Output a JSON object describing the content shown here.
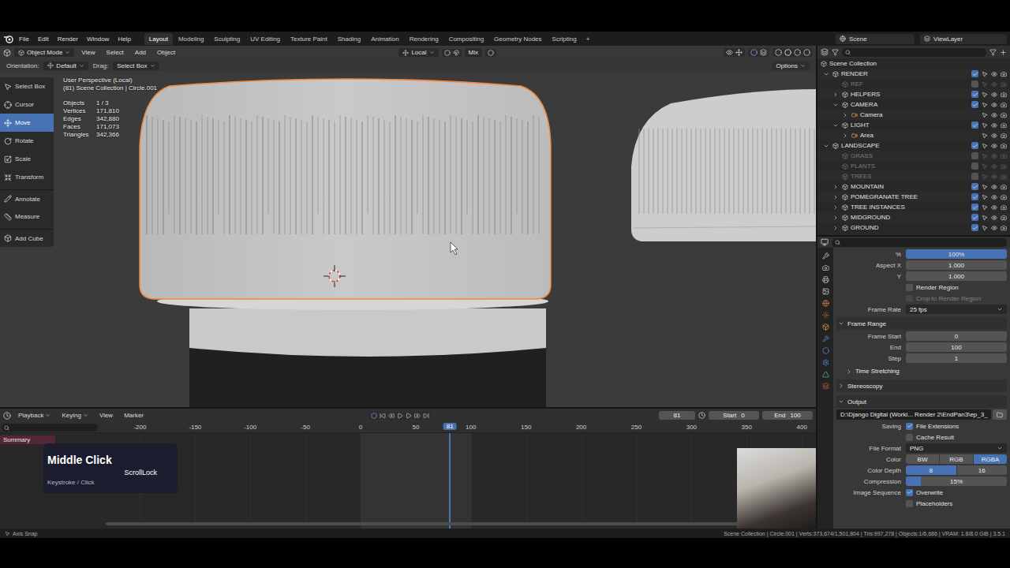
{
  "topbar": {
    "menus": [
      "File",
      "Edit",
      "Render",
      "Window",
      "Help"
    ],
    "workspaces": [
      {
        "label": "Layout",
        "selected": true
      },
      {
        "label": "Modeling",
        "selected": false
      },
      {
        "label": "Sculpting",
        "selected": false
      },
      {
        "label": "UV Editing",
        "selected": false
      },
      {
        "label": "Texture Paint",
        "selected": false
      },
      {
        "label": "Shading",
        "selected": false
      },
      {
        "label": "Animation",
        "selected": false
      },
      {
        "label": "Rendering",
        "selected": false
      },
      {
        "label": "Compositing",
        "selected": false
      },
      {
        "label": "Geometry Nodes",
        "selected": false
      },
      {
        "label": "Scripting",
        "selected": false
      }
    ],
    "add_workspace": "+",
    "scene": "Scene",
    "view_layer": "ViewLayer"
  },
  "viewport": {
    "mode": "Object Mode",
    "menus": [
      "View",
      "Select",
      "Add",
      "Object"
    ],
    "transform_orientation": "Local",
    "pivot_mix": "Mix",
    "orientation_label": "Orientation:",
    "orientation": "Default",
    "drag_label": "Drag:",
    "drag": "Select Box",
    "options": "Options",
    "tools": [
      {
        "label": "Select Box",
        "selected": false,
        "separator_before": false
      },
      {
        "label": "Cursor",
        "selected": false,
        "separator_before": false
      },
      {
        "label": "Move",
        "selected": true,
        "separator_before": false
      },
      {
        "label": "Rotate",
        "selected": false,
        "separator_before": false
      },
      {
        "label": "Scale",
        "selected": false,
        "separator_before": false
      },
      {
        "label": "Transform",
        "selected": false,
        "separator_before": false
      },
      {
        "label": "Annotate",
        "selected": false,
        "separator_before": true
      },
      {
        "label": "Measure",
        "selected": false,
        "separator_before": false
      },
      {
        "label": "Add Cube",
        "selected": false,
        "separator_before": true
      }
    ],
    "view_name": "User Perspective (Local)",
    "object_info": "(81) Scene Collection | Circle.001",
    "stats": [
      {
        "label": "Objects",
        "value": "1 / 3"
      },
      {
        "label": "Vertices",
        "value": "171,810"
      },
      {
        "label": "Edges",
        "value": "342,880"
      },
      {
        "label": "Faces",
        "value": "171,073"
      },
      {
        "label": "Triangles",
        "value": "342,366"
      }
    ]
  },
  "outliner": {
    "root": "Scene Collection",
    "items": [
      {
        "label": "RENDER",
        "depth": 0,
        "kind": "collection",
        "has_children": true,
        "expanded": true,
        "checked": true,
        "disabled": false
      },
      {
        "label": "REF",
        "depth": 1,
        "kind": "collection",
        "has_children": false,
        "expanded": false,
        "checked": false,
        "disabled": true
      },
      {
        "label": "HELPERS",
        "depth": 1,
        "kind": "collection",
        "has_children": true,
        "expanded": false,
        "checked": true,
        "disabled": false
      },
      {
        "label": "CAMERA",
        "depth": 1,
        "kind": "collection",
        "has_children": true,
        "expanded": true,
        "checked": true,
        "disabled": false
      },
      {
        "label": "Camera",
        "depth": 2,
        "kind": "object",
        "has_children": true,
        "expanded": false,
        "checked": false,
        "disabled": false
      },
      {
        "label": "LIGHT",
        "depth": 1,
        "kind": "collection",
        "has_children": true,
        "expanded": true,
        "checked": true,
        "disabled": false
      },
      {
        "label": "Area",
        "depth": 2,
        "kind": "object",
        "has_children": true,
        "expanded": false,
        "checked": false,
        "disabled": false
      },
      {
        "label": "LANDSCAPE",
        "depth": 0,
        "kind": "collection",
        "has_children": true,
        "expanded": true,
        "checked": true,
        "disabled": false
      },
      {
        "label": "GRASS",
        "depth": 1,
        "kind": "collection",
        "has_children": false,
        "expanded": false,
        "checked": false,
        "disabled": true
      },
      {
        "label": "PLANTS",
        "depth": 1,
        "kind": "collection",
        "has_children": false,
        "expanded": false,
        "checked": false,
        "disabled": true
      },
      {
        "label": "TREES",
        "depth": 1,
        "kind": "collection",
        "has_children": false,
        "expanded": false,
        "checked": false,
        "disabled": true
      },
      {
        "label": "MOUNTAIN",
        "depth": 1,
        "kind": "collection",
        "has_children": true,
        "expanded": false,
        "checked": true,
        "disabled": false
      },
      {
        "label": "POMEGRANATE TREE",
        "depth": 1,
        "kind": "collection",
        "has_children": true,
        "expanded": false,
        "checked": true,
        "disabled": false
      },
      {
        "label": "TREE INSTANCES",
        "depth": 1,
        "kind": "collection",
        "has_children": true,
        "expanded": false,
        "checked": true,
        "disabled": false
      },
      {
        "label": "MIDGROUND",
        "depth": 1,
        "kind": "collection",
        "has_children": true,
        "expanded": false,
        "checked": true,
        "disabled": false
      },
      {
        "label": "GROUND",
        "depth": 1,
        "kind": "collection",
        "has_children": true,
        "expanded": false,
        "checked": true,
        "disabled": false
      }
    ]
  },
  "properties": {
    "rows": [
      {
        "kind": "slider",
        "label": "%",
        "value": "100%",
        "level": 1
      },
      {
        "kind": "field",
        "label": "Aspect X",
        "value": "1.000"
      },
      {
        "kind": "field",
        "label": "Y",
        "value": "1.000"
      },
      {
        "kind": "checkbox",
        "label": "",
        "text": "Render Region",
        "checked": false,
        "disabled": false
      },
      {
        "kind": "checkbox",
        "label": "",
        "text": "Crop to Render Region",
        "checked": false,
        "disabled": true
      },
      {
        "kind": "dropdown",
        "label": "Frame Rate",
        "value": "25 fps"
      },
      {
        "kind": "section",
        "label": "Frame Range",
        "expanded": true
      },
      {
        "kind": "field",
        "label": "Frame Start",
        "value": "0"
      },
      {
        "kind": "field",
        "label": "End",
        "value": "100"
      },
      {
        "kind": "field",
        "label": "Step",
        "value": "1"
      },
      {
        "kind": "subsection",
        "label": "Time Stretching",
        "expanded": false
      },
      {
        "kind": "section",
        "label": "Stereoscopy",
        "expanded": false
      },
      {
        "kind": "section",
        "label": "Output",
        "expanded": true
      },
      {
        "kind": "path",
        "label": "",
        "value": "D:\\Django Digital (Worki... Render 2\\EndPan3\\ep_3_"
      },
      {
        "kind": "checkbox",
        "label": "Saving",
        "text": "File Extensions",
        "checked": true,
        "disabled": false
      },
      {
        "kind": "checkbox",
        "label": "",
        "text": "Cache Result",
        "checked": false,
        "disabled": false
      },
      {
        "kind": "dropdown",
        "label": "File Format",
        "value": "PNG"
      },
      {
        "kind": "toggle",
        "label": "Color",
        "options": [
          {
            "label": "BW",
            "selected": false
          },
          {
            "label": "RGB",
            "selected": false
          },
          {
            "label": "RGBA",
            "selected": true
          }
        ]
      },
      {
        "kind": "toggle",
        "label": "Color Depth",
        "options": [
          {
            "label": "8",
            "selected": true
          },
          {
            "label": "16",
            "selected": false
          }
        ]
      },
      {
        "kind": "slider",
        "label": "Compression",
        "value": "15%",
        "level": 0.15
      },
      {
        "kind": "checkbox",
        "label": "Image Sequence",
        "text": "Overwrite",
        "checked": true,
        "disabled": false
      },
      {
        "kind": "checkbox",
        "label": "",
        "text": "Placeholders",
        "checked": false,
        "disabled": false
      }
    ]
  },
  "timeline": {
    "menus": [
      {
        "label": "Playback",
        "dropdown": true
      },
      {
        "label": "Keying",
        "dropdown": true
      },
      {
        "label": "View",
        "dropdown": false
      },
      {
        "label": "Marker",
        "dropdown": false
      }
    ],
    "current_frame": "81",
    "start_label": "Start",
    "start": "0",
    "end_label": "End",
    "end": "100",
    "ruler": [
      "-200",
      "-150",
      "-100",
      "-50",
      "0",
      "50",
      "100",
      "150",
      "200",
      "250",
      "300",
      "350",
      "400"
    ],
    "playhead": "81",
    "channels": [
      {
        "label": "Summary",
        "selected": true
      }
    ]
  },
  "screencast": {
    "title": "Middle Click",
    "key": "ScrollLock",
    "caption": "Keystroke / Click"
  },
  "status_bar": {
    "left": "Axis Snap",
    "right": "Scene Collection | Circle.001 | Verts:373,674/1,501,804 | Tris:997,278 | Objects:1/6,686 | VRAM: 1.8/8.0 GiB | 3.5.1"
  }
}
